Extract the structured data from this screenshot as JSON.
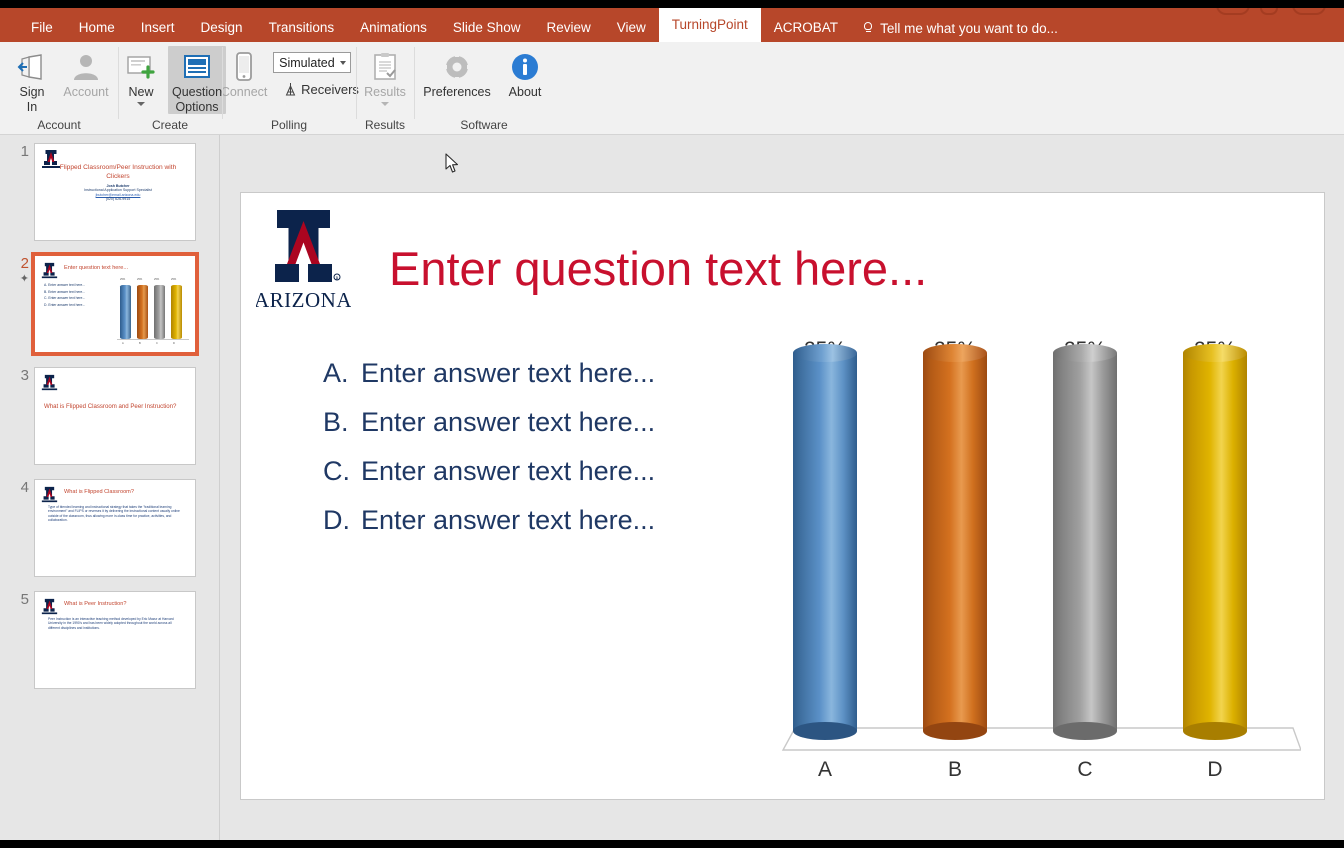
{
  "window": {
    "accent_color": "#b7472a"
  },
  "ribbon": {
    "tabs": [
      {
        "label": "File",
        "active": false
      },
      {
        "label": "Home",
        "active": false
      },
      {
        "label": "Insert",
        "active": false
      },
      {
        "label": "Design",
        "active": false
      },
      {
        "label": "Transitions",
        "active": false
      },
      {
        "label": "Animations",
        "active": false
      },
      {
        "label": "Slide Show",
        "active": false
      },
      {
        "label": "Review",
        "active": false
      },
      {
        "label": "View",
        "active": false
      },
      {
        "label": "TurningPoint",
        "active": true
      },
      {
        "label": "ACROBAT",
        "active": false
      }
    ],
    "tell_me": "Tell me what you want to do...",
    "groups": [
      {
        "name": "Account",
        "label": "Account",
        "buttons": [
          {
            "label_line1": "Sign",
            "label_line2": "In",
            "icon": "sign-in-icon",
            "disabled": false
          },
          {
            "label_line1": "Account",
            "label_line2": "",
            "icon": "person-icon",
            "disabled": true
          }
        ]
      },
      {
        "name": "Create",
        "label": "Create",
        "buttons": [
          {
            "label_line1": "New",
            "label_line2": "",
            "icon": "new-slide-icon",
            "disabled": false,
            "has_dropdown": true
          },
          {
            "label_line1": "Question",
            "label_line2": "Options",
            "icon": "question-options-icon",
            "disabled": false,
            "selected": true
          }
        ]
      },
      {
        "name": "Polling",
        "label": "Polling",
        "buttons": [
          {
            "label_line1": "Connect",
            "label_line2": "",
            "icon": "phone-icon",
            "disabled": true
          }
        ],
        "combo_value": "Simulated",
        "receivers_label": "Receivers"
      },
      {
        "name": "Results",
        "label": "Results",
        "buttons": [
          {
            "label_line1": "Results",
            "label_line2": "",
            "icon": "clipboard-check-icon",
            "disabled": true,
            "has_dropdown": true
          }
        ]
      },
      {
        "name": "Software",
        "label": "Software",
        "buttons": [
          {
            "label_line1": "Preferences",
            "label_line2": "",
            "icon": "gear-icon",
            "disabled": false
          },
          {
            "label_line1": "About",
            "label_line2": "",
            "icon": "info-icon",
            "disabled": false
          }
        ]
      }
    ]
  },
  "slide_panel": {
    "slides": [
      {
        "number": "1",
        "selected": false,
        "has_animation": false,
        "title": "Flipped Classroom/Peer Instruction with Clickers",
        "presenter": "Josh Butcher",
        "presenter_role": "Instructional Application Support Specialist",
        "presenter_email": "jbutcher@email.arizona.edu",
        "presenter_phone": "(520) 626-9915"
      },
      {
        "number": "2",
        "selected": true,
        "has_animation": true,
        "title": "Enter question text here...",
        "answers": [
          "A.  Enter answer text here...",
          "B.  Enter answer text here...",
          "C.  Enter answer text here...",
          "D.  Enter answer text here..."
        ]
      },
      {
        "number": "3",
        "selected": false,
        "has_animation": false,
        "title": "What is Flipped Classroom and Peer Instruction?"
      },
      {
        "number": "4",
        "selected": false,
        "has_animation": false,
        "heading": "What is Flipped Classroom?",
        "body": "Type of blended learning and instructional strategy that takes the \"traditional learning environment\" and FLIPS or reverses it by delivering the instructional content usually online outside of the classroom, thus allowing more in-class time for practice, activities, and collaboration."
      },
      {
        "number": "5",
        "selected": false,
        "has_animation": false,
        "heading": "What is Peer Instruction?",
        "body": "Peer Instruction is an interactive teaching method developed by Eric Mazur at Harvard University in the 1990's and has been widely adopted throughout the world across all different disciplines and institutions."
      }
    ]
  },
  "slide": {
    "logo_word": "ARIZONA",
    "question_title": "Enter question text here...",
    "answers": [
      {
        "letter": "A.",
        "text": "Enter answer text here..."
      },
      {
        "letter": "B.",
        "text": "Enter answer text here..."
      },
      {
        "letter": "C.",
        "text": "Enter answer text here..."
      },
      {
        "letter": "D.",
        "text": "Enter answer text here..."
      }
    ]
  },
  "chart_data": {
    "type": "bar",
    "title": "",
    "xlabel": "",
    "ylabel": "",
    "categories": [
      "A",
      "B",
      "C",
      "D"
    ],
    "values": [
      25,
      25,
      25,
      25
    ],
    "data_labels": [
      "25%",
      "25%",
      "25%",
      "25%"
    ],
    "colors": [
      "#4A7EBB",
      "#D2691E",
      "#9E9E9E",
      "#E8B800"
    ],
    "ylim": [
      0,
      30
    ],
    "grid": false,
    "legend": "none",
    "style": "3d-cylinder"
  }
}
